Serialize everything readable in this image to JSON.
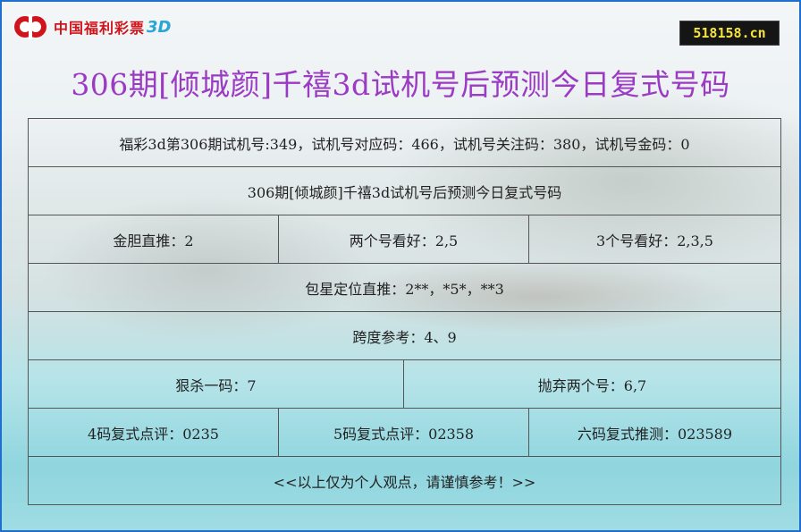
{
  "header": {
    "logo_text": "中国福利彩票",
    "logo_3d": "3D",
    "site_badge": "518158.cn"
  },
  "title": "306期[倾城颜]千禧3d试机号后预测今日复式号码",
  "rows": {
    "trial_info": "福彩3d第306期试机号:349，试机号对应码：466，试机号关注码：380，试机号金码：0",
    "subtitle": "306期[倾城颜]千禧3d试机号后预测今日复式号码",
    "gold_direct": "金胆直推：2",
    "two_numbers": "两个号看好：2,5",
    "three_numbers": "3个号看好：2,3,5",
    "position": "包星定位直推：2**，*5*，**3",
    "span": "跨度参考：4、9",
    "kill_one": "狠杀一码：7",
    "discard_two": "抛弃两个号：6,7",
    "compound_4": "4码复式点评：0235",
    "compound_5": "5码复式点评：02358",
    "compound_6": "六码复式推测：023589",
    "disclaimer": "<<以上仅为个人观点，请谨慎参考！>>"
  },
  "colors": {
    "title": "#9b3bc4",
    "border": "#1e6fd0",
    "logo_red": "#d0141c",
    "badge_bg": "#151515",
    "badge_text": "#f5e43a"
  }
}
